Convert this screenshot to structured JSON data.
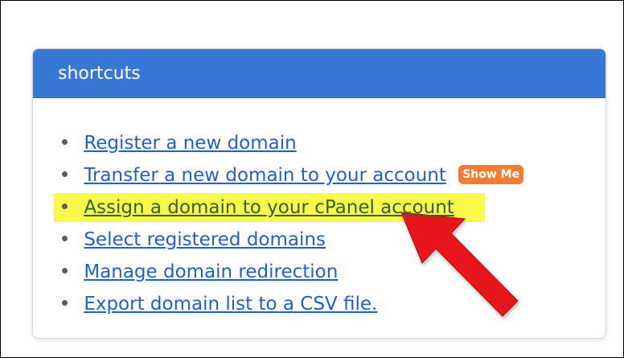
{
  "shortcuts_panel": {
    "title": "shortcuts",
    "links": [
      {
        "label": "Register a new domain"
      },
      {
        "label": "Transfer a new domain to your account",
        "badge": "Show Me"
      },
      {
        "label": "Assign a domain to your cPanel account",
        "highlighted": true
      },
      {
        "label": "Select registered domains"
      },
      {
        "label": "Manage domain redirection"
      },
      {
        "label": "Export domain list to a CSV file."
      }
    ]
  },
  "annotations": {
    "arrow_icon": "red-arrow-icon",
    "arrow_color": "#e8141c",
    "highlight_color": "#f9f94b"
  },
  "colors": {
    "header_bg": "#3877d6",
    "link": "#1e62c8",
    "badge_bg": "#f57c33"
  }
}
